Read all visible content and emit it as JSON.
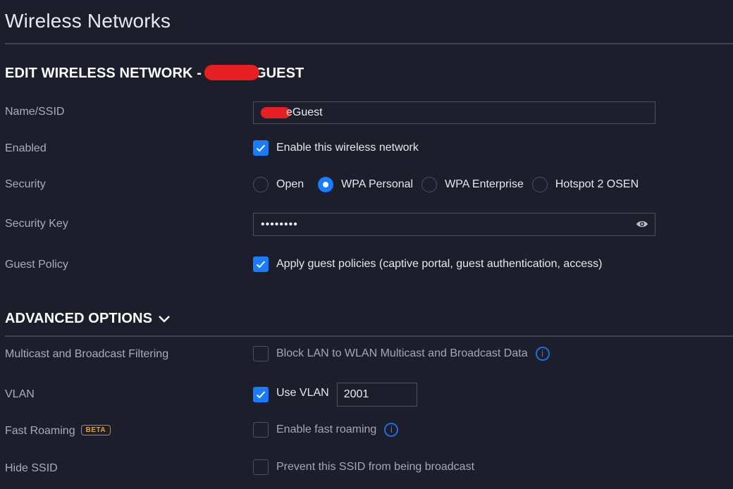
{
  "page": {
    "title": "Wireless Networks"
  },
  "edit_section": {
    "title_prefix": "EDIT WIRELESS NETWORK -",
    "title_suffix": "GUEST"
  },
  "fields": {
    "name": {
      "label": "Name/SSID",
      "value_suffix": "eGuest"
    },
    "enabled": {
      "label": "Enabled",
      "checkbox_label": "Enable this wireless network",
      "checked": true
    },
    "security": {
      "label": "Security",
      "options": [
        "Open",
        "WPA Personal",
        "WPA Enterprise",
        "Hotspot 2 OSEN"
      ],
      "selected": "WPA Personal"
    },
    "security_key": {
      "label": "Security Key",
      "masked_value": "••••••••",
      "reveal_icon": "eye-icon"
    },
    "guest_policy": {
      "label": "Guest Policy",
      "checkbox_label": "Apply guest policies (captive portal, guest authentication, access)",
      "checked": true
    }
  },
  "advanced": {
    "title": "ADVANCED OPTIONS",
    "toggle_icon": "chevron-down-icon",
    "multicast": {
      "label": "Multicast and Broadcast Filtering",
      "checkbox_label": "Block LAN to WLAN Multicast and Broadcast Data",
      "checked": false,
      "info_icon": "i"
    },
    "vlan": {
      "label": "VLAN",
      "checkbox_label": "Use VLAN",
      "checked": true,
      "value": "2001"
    },
    "fast_roaming": {
      "label": "Fast Roaming",
      "badge": "BETA",
      "checkbox_label": "Enable fast roaming",
      "checked": false,
      "info_icon": "i"
    },
    "hide_ssid": {
      "label": "Hide SSID",
      "checkbox_label": "Prevent this SSID from being broadcast",
      "checked": false
    }
  },
  "colors": {
    "background": "#1c1e2c",
    "accent": "#1a7bff",
    "beta": "#e2a43b",
    "redaction": "#e61f23"
  }
}
